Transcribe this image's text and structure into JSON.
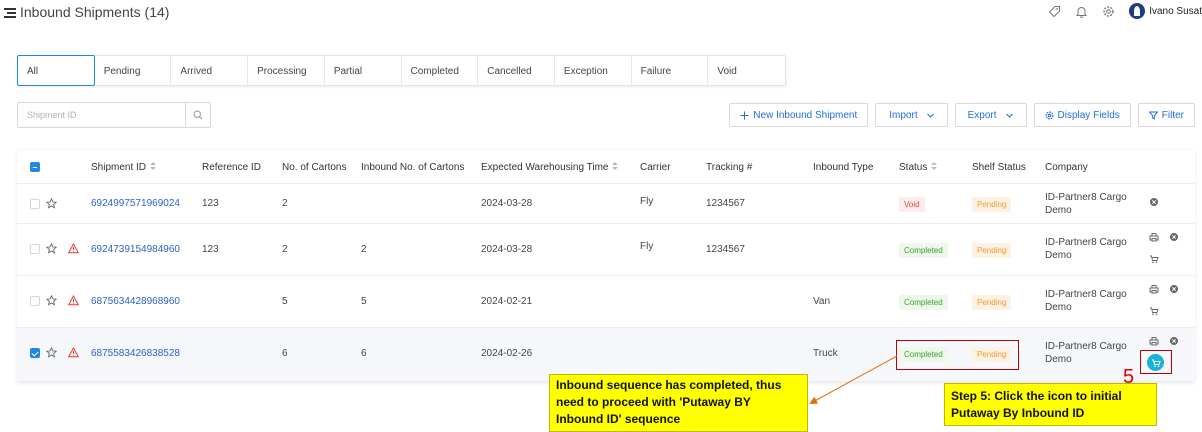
{
  "header": {
    "title": "Inbound Shipments (14)",
    "user_name": "Ivano Susat"
  },
  "tabs": [
    {
      "label": "All",
      "active": true
    },
    {
      "label": "Pending"
    },
    {
      "label": "Arrived"
    },
    {
      "label": "Processing"
    },
    {
      "label": "Partial"
    },
    {
      "label": "Completed"
    },
    {
      "label": "Cancelled"
    },
    {
      "label": "Exception"
    },
    {
      "label": "Failure"
    },
    {
      "label": "Void"
    }
  ],
  "search": {
    "placeholder": "Shipment ID"
  },
  "toolbar": {
    "new_label": "New Inbound Shipment",
    "import_label": "Import",
    "export_label": "Export",
    "display_fields_label": "Display Fields",
    "filter_label": "Filter"
  },
  "table": {
    "columns": {
      "shipment_id": "Shipment ID",
      "reference_id": "Reference ID",
      "cartons": "No. of Cartons",
      "inbound_cartons": "Inbound No. of Cartons",
      "expected_time": "Expected Warehousing Time",
      "carrier": "Carrier",
      "tracking": "Tracking #",
      "inbound_type": "Inbound Type",
      "status": "Status",
      "shelf_status": "Shelf Status",
      "company": "Company"
    },
    "rows": [
      {
        "shipment_id": "6924997571969024",
        "reference_id": "123",
        "cartons": "2",
        "inbound_cartons": "",
        "expected_time": "2024-03-28",
        "carrier": "Fly",
        "tracking": "1234567",
        "inbound_type": "",
        "status": "Void",
        "shelf_status": "Pending",
        "company_line1": "ID-Partner8 Cargo",
        "company_line2": "Demo",
        "warning": false,
        "selected": false
      },
      {
        "shipment_id": "6924739154984960",
        "reference_id": "123",
        "cartons": "2",
        "inbound_cartons": "2",
        "expected_time": "2024-03-28",
        "carrier": "Fly",
        "tracking": "1234567",
        "inbound_type": "",
        "status": "Completed",
        "shelf_status": "Pending",
        "company_line1": "ID-Partner8 Cargo",
        "company_line2": "Demo",
        "warning": true,
        "selected": false
      },
      {
        "shipment_id": "6875634428968960",
        "reference_id": "",
        "cartons": "5",
        "inbound_cartons": "5",
        "expected_time": "2024-02-21",
        "carrier": "",
        "tracking": "",
        "inbound_type": "Van",
        "status": "Completed",
        "shelf_status": "Pending",
        "company_line1": "ID-Partner8 Cargo",
        "company_line2": "Demo",
        "warning": true,
        "selected": false
      },
      {
        "shipment_id": "6875583426838528",
        "reference_id": "",
        "cartons": "6",
        "inbound_cartons": "6",
        "expected_time": "2024-02-26",
        "carrier": "",
        "tracking": "",
        "inbound_type": "Truck",
        "status": "Completed",
        "shelf_status": "Pending",
        "company_line1": "ID-Partner8 Cargo",
        "company_line2": "Demo",
        "warning": true,
        "selected": true
      }
    ]
  },
  "annotations": {
    "step_number": "5",
    "note_left": "Inbound sequence has completed, thus need to proceed with 'Putaway BY Inbound ID' sequence",
    "note_right": "Step 5: Click the icon to initial Putaway By Inbound ID",
    "colors": {
      "highlight": "#c00000",
      "note_bg": "#ffff00",
      "arrow": "#e46c0a"
    }
  },
  "colors": {
    "accent": "#1e88e5",
    "link": "#2f62c8",
    "cart_button": "#1ab3d8"
  }
}
